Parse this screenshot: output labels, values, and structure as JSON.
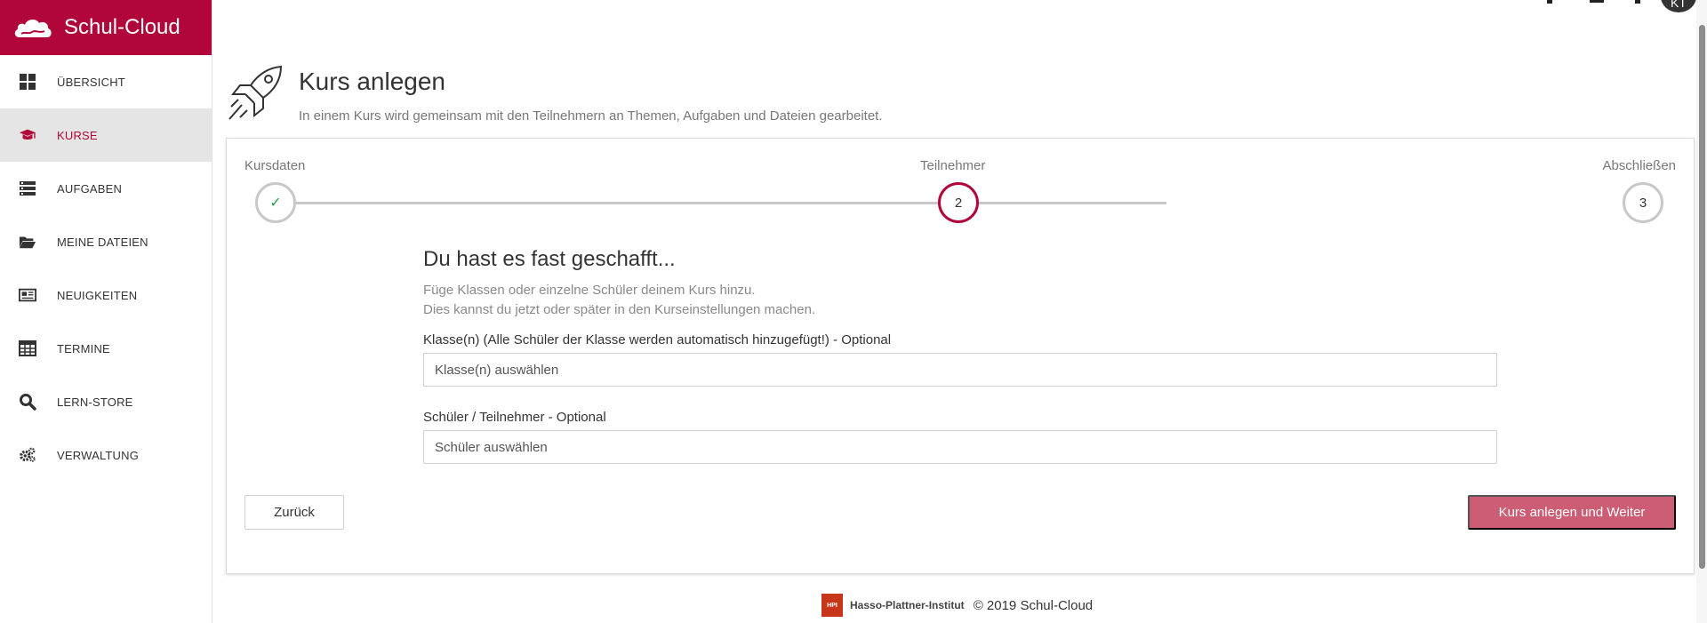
{
  "brand": {
    "name": "Schul-Cloud",
    "color": "#b1063a"
  },
  "sidebar": {
    "items": [
      {
        "label": "ÜBERSICHT",
        "icon": "dashboard-icon",
        "active": false
      },
      {
        "label": "KURSE",
        "icon": "graduation-cap-icon",
        "active": true
      },
      {
        "label": "AUFGABEN",
        "icon": "tasks-icon",
        "active": false
      },
      {
        "label": "MEINE DATEIEN",
        "icon": "folder-icon",
        "active": false
      },
      {
        "label": "NEUIGKEITEN",
        "icon": "newspaper-icon",
        "active": false
      },
      {
        "label": "TERMINE",
        "icon": "calendar-table-icon",
        "active": false
      },
      {
        "label": "LERN-STORE",
        "icon": "search-icon",
        "active": false
      },
      {
        "label": "VERWALTUNG",
        "icon": "gears-icon",
        "active": false
      }
    ]
  },
  "user": {
    "initials": "KT"
  },
  "header": {
    "title": "Kurs anlegen",
    "subtitle": "In einem Kurs wird gemeinsam mit den Teilnehmern an Themen, Aufgaben und Dateien gearbeitet.",
    "icon": "rocket-icon"
  },
  "stepper": {
    "steps": [
      {
        "label": "Kursdaten",
        "marker": "✓",
        "state": "done"
      },
      {
        "label": "Teilnehmer",
        "marker": "2",
        "state": "current"
      },
      {
        "label": "Abschließen",
        "marker": "3",
        "state": "upcoming"
      }
    ]
  },
  "form": {
    "title": "Du hast es fast geschafft...",
    "hint_line1": "Füge Klassen oder einzelne Schüler deinem Kurs hinzu.",
    "hint_line2": "Dies kannst du jetzt oder später in den Kurseinstellungen machen.",
    "classes_label": "Klasse(n) (Alle Schüler der Klasse werden automatisch hinzugefügt!) - Optional",
    "classes_placeholder": "Klasse(n) auswählen",
    "students_label": "Schüler / Teilnehmer - Optional",
    "students_placeholder": "Schüler auswählen"
  },
  "buttons": {
    "back": "Zurück",
    "next": "Kurs anlegen und Weiter"
  },
  "footer": {
    "hpi_logo_text": "HPI",
    "hpi_name": "Hasso-Plattner-Institut",
    "copyright": "© 2019 Schul-Cloud"
  }
}
